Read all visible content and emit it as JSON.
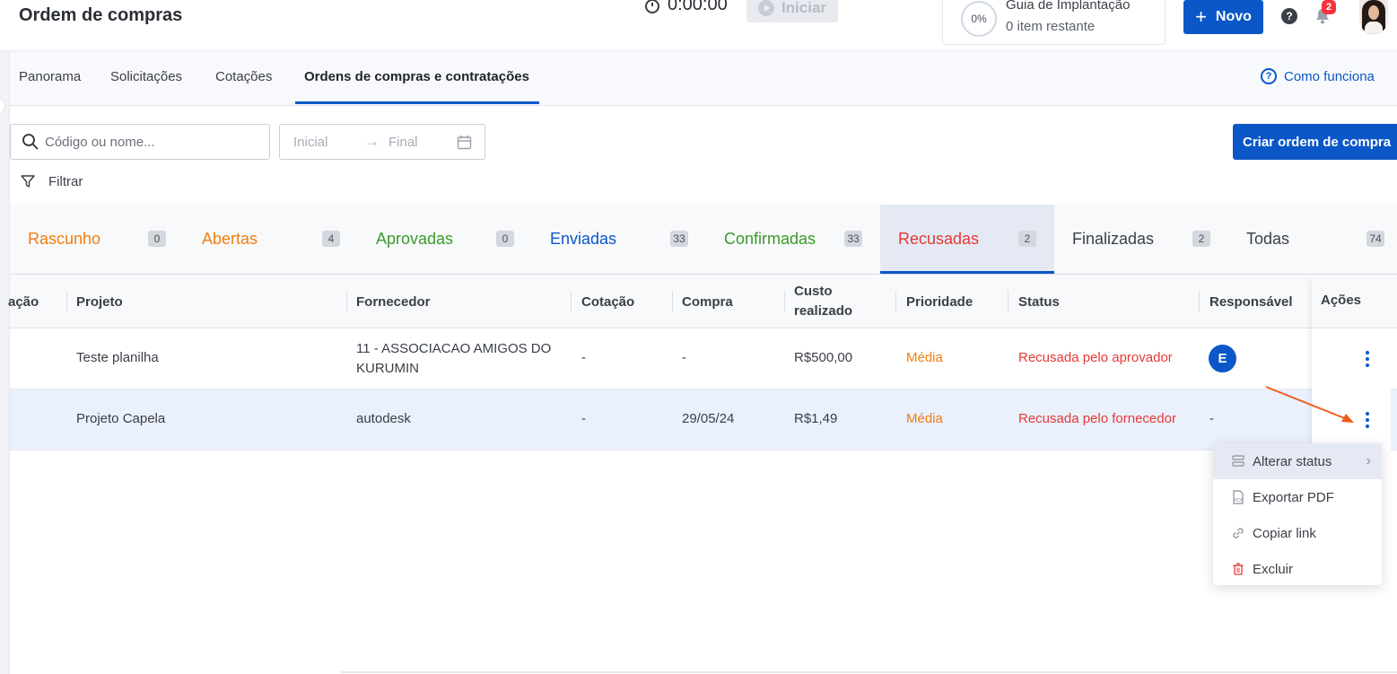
{
  "header": {
    "title": "Ordem de compras",
    "timer": "0:00:00",
    "start_label": "Iniciar",
    "guide_percent": "0%",
    "guide_title": "Guia de Implantação",
    "guide_subtitle": "0 item restante",
    "new_label": "Novo",
    "help_glyph": "?",
    "notification_count": "2"
  },
  "subnav": {
    "items": [
      "Panorama",
      "Solicitações",
      "Cotações",
      "Ordens de compras e contratações"
    ],
    "active_index": 3,
    "help_link": "Como funciona",
    "help_glyph": "?"
  },
  "filters": {
    "search_placeholder": "Código ou nome...",
    "date_start": "Inicial",
    "date_end": "Final",
    "create_label": "Criar ordem de compra",
    "filter_label": "Filtrar"
  },
  "status_tabs": [
    {
      "label": "Rascunho",
      "count": "0",
      "color": "#ef7f10"
    },
    {
      "label": "Abertas",
      "count": "4",
      "color": "#ef7f10"
    },
    {
      "label": "Aprovadas",
      "count": "0",
      "color": "#3a9a2a"
    },
    {
      "label": "Enviadas",
      "count": "33",
      "color": "#0b57c7"
    },
    {
      "label": "Confirmadas",
      "count": "33",
      "color": "#3a9a2a"
    },
    {
      "label": "Recusadas",
      "count": "2",
      "color": "#e53935",
      "active": true
    },
    {
      "label": "Finalizadas",
      "count": "2",
      "color": "#3a3f47"
    },
    {
      "label": "Todas",
      "count": "74",
      "color": "#3a3f47"
    }
  ],
  "table": {
    "columns": [
      "ação",
      "Projeto",
      "Fornecedor",
      "Cotação",
      "Compra",
      "Custo realizado",
      "Prioridade",
      "Status",
      "Responsável",
      "Ações"
    ],
    "rows": [
      {
        "projeto": "Teste planilha",
        "fornecedor": "11 - ASSOCIACAO AMIGOS DO KURUMIN",
        "cotacao": "-",
        "compra": "-",
        "custo": "R$500,00",
        "prioridade": "Média",
        "status": "Recusada pelo aprovador",
        "responsavel": "E"
      },
      {
        "projeto": "Projeto Capela",
        "fornecedor": "autodesk",
        "cotacao": "-",
        "compra": "29/05/24",
        "custo": "R$1,49",
        "prioridade": "Média",
        "status": "Recusada pelo fornecedor",
        "responsavel": "-"
      }
    ]
  },
  "context_menu": {
    "items": [
      {
        "label": "Alterar status",
        "icon": "status-icon"
      },
      {
        "label": "Exportar PDF",
        "icon": "pdf-icon"
      },
      {
        "label": "Copiar link",
        "icon": "link-icon"
      },
      {
        "label": "Excluir",
        "icon": "trash-icon"
      }
    ]
  },
  "colors": {
    "primary": "#0b57c7",
    "warning": "#ef7f10",
    "danger": "#e53935",
    "success": "#3a9a2a",
    "annotation_arrow": "#f05a1a"
  }
}
